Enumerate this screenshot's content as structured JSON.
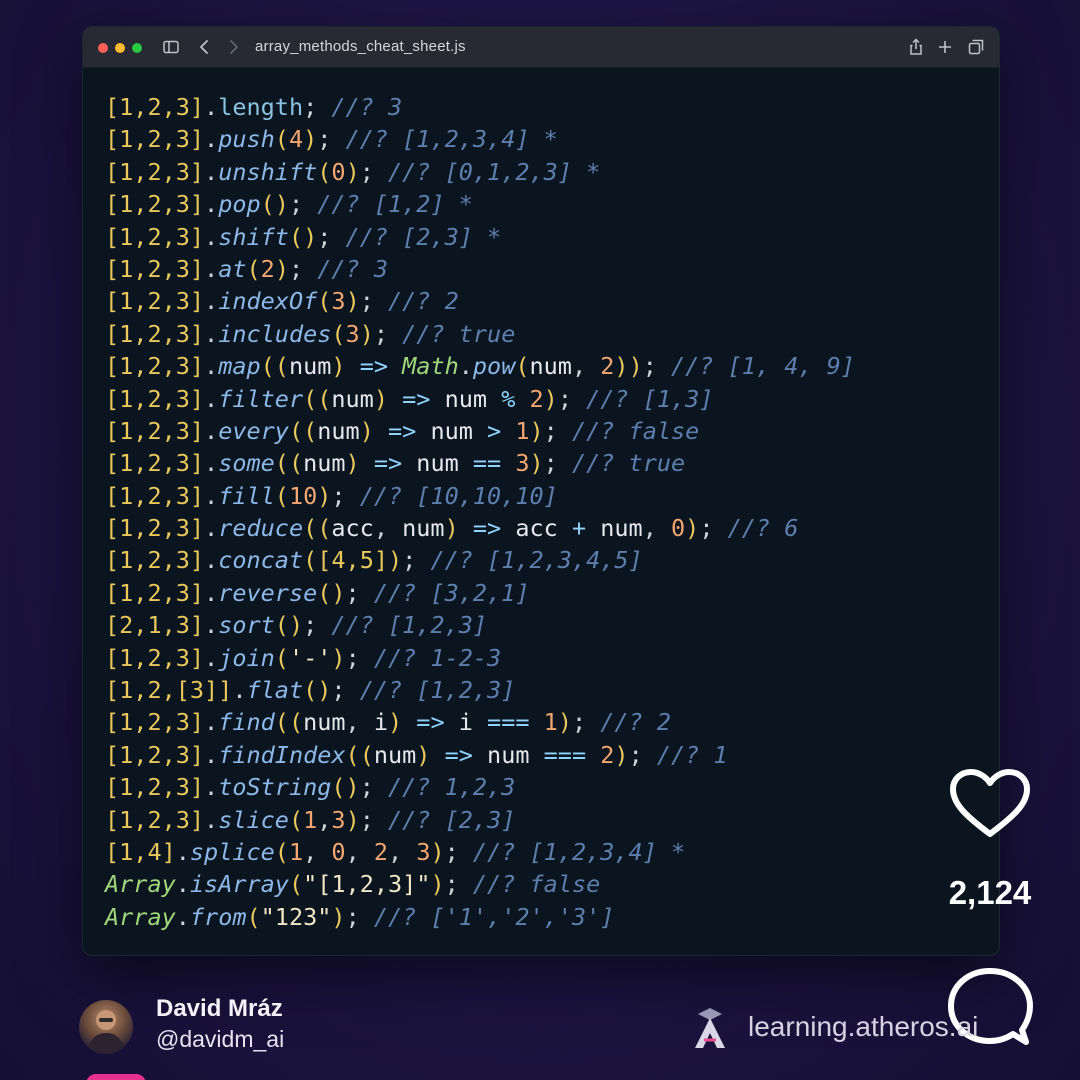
{
  "window": {
    "title": "array_methods_cheat_sheet.js"
  },
  "code_lines": [
    [
      [
        "b",
        "[1,2,3]"
      ],
      [
        "d",
        "."
      ],
      [
        "p",
        "length"
      ],
      [
        "d",
        "; "
      ],
      [
        "c",
        "//? 3"
      ]
    ],
    [
      [
        "b",
        "[1,2,3]"
      ],
      [
        "d",
        "."
      ],
      [
        "m",
        "push"
      ],
      [
        "b",
        "("
      ],
      [
        "n",
        "4"
      ],
      [
        "b",
        ")"
      ],
      [
        "d",
        "; "
      ],
      [
        "c",
        "//? [1,2,3,4] *"
      ]
    ],
    [
      [
        "b",
        "[1,2,3]"
      ],
      [
        "d",
        "."
      ],
      [
        "m",
        "unshift"
      ],
      [
        "b",
        "("
      ],
      [
        "n",
        "0"
      ],
      [
        "b",
        ")"
      ],
      [
        "d",
        "; "
      ],
      [
        "c",
        "//? [0,1,2,3] *"
      ]
    ],
    [
      [
        "b",
        "[1,2,3]"
      ],
      [
        "d",
        "."
      ],
      [
        "m",
        "pop"
      ],
      [
        "b",
        "()"
      ],
      [
        "d",
        "; "
      ],
      [
        "c",
        "//? [1,2] *"
      ]
    ],
    [
      [
        "b",
        "[1,2,3]"
      ],
      [
        "d",
        "."
      ],
      [
        "m",
        "shift"
      ],
      [
        "b",
        "()"
      ],
      [
        "d",
        "; "
      ],
      [
        "c",
        "//? [2,3] *"
      ]
    ],
    [
      [
        "b",
        "[1,2,3]"
      ],
      [
        "d",
        "."
      ],
      [
        "m",
        "at"
      ],
      [
        "b",
        "("
      ],
      [
        "n",
        "2"
      ],
      [
        "b",
        ")"
      ],
      [
        "d",
        "; "
      ],
      [
        "c",
        "//? 3"
      ]
    ],
    [
      [
        "b",
        "[1,2,3]"
      ],
      [
        "d",
        "."
      ],
      [
        "m",
        "indexOf"
      ],
      [
        "b",
        "("
      ],
      [
        "n",
        "3"
      ],
      [
        "b",
        ")"
      ],
      [
        "d",
        "; "
      ],
      [
        "c",
        "//? 2"
      ]
    ],
    [
      [
        "b",
        "[1,2,3]"
      ],
      [
        "d",
        "."
      ],
      [
        "m",
        "includes"
      ],
      [
        "b",
        "("
      ],
      [
        "n",
        "3"
      ],
      [
        "b",
        ")"
      ],
      [
        "d",
        "; "
      ],
      [
        "c",
        "//? true"
      ]
    ],
    [
      [
        "b",
        "[1,2,3]"
      ],
      [
        "d",
        "."
      ],
      [
        "m",
        "map"
      ],
      [
        "b",
        "(("
      ],
      [
        "v",
        "num"
      ],
      [
        "b",
        ")"
      ],
      [
        "o",
        " => "
      ],
      [
        "g",
        "Math"
      ],
      [
        "d",
        "."
      ],
      [
        "m",
        "pow"
      ],
      [
        "b",
        "("
      ],
      [
        "v",
        "num"
      ],
      [
        "d",
        ", "
      ],
      [
        "n",
        "2"
      ],
      [
        "b",
        "))"
      ],
      [
        "d",
        "; "
      ],
      [
        "c",
        "//? [1, 4, 9]"
      ]
    ],
    [
      [
        "b",
        "[1,2,3]"
      ],
      [
        "d",
        "."
      ],
      [
        "m",
        "filter"
      ],
      [
        "b",
        "(("
      ],
      [
        "v",
        "num"
      ],
      [
        "b",
        ")"
      ],
      [
        "o",
        " => "
      ],
      [
        "v",
        "num"
      ],
      [
        "o",
        " % "
      ],
      [
        "n",
        "2"
      ],
      [
        "b",
        ")"
      ],
      [
        "d",
        "; "
      ],
      [
        "c",
        "//? [1,3]"
      ]
    ],
    [
      [
        "b",
        "[1,2,3]"
      ],
      [
        "d",
        "."
      ],
      [
        "m",
        "every"
      ],
      [
        "b",
        "(("
      ],
      [
        "v",
        "num"
      ],
      [
        "b",
        ")"
      ],
      [
        "o",
        " => "
      ],
      [
        "v",
        "num"
      ],
      [
        "o",
        " > "
      ],
      [
        "n",
        "1"
      ],
      [
        "b",
        ")"
      ],
      [
        "d",
        "; "
      ],
      [
        "c",
        "//? false"
      ]
    ],
    [
      [
        "b",
        "[1,2,3]"
      ],
      [
        "d",
        "."
      ],
      [
        "m",
        "some"
      ],
      [
        "b",
        "(("
      ],
      [
        "v",
        "num"
      ],
      [
        "b",
        ")"
      ],
      [
        "o",
        " => "
      ],
      [
        "v",
        "num"
      ],
      [
        "o",
        " == "
      ],
      [
        "n",
        "3"
      ],
      [
        "b",
        ")"
      ],
      [
        "d",
        "; "
      ],
      [
        "c",
        "//? true"
      ]
    ],
    [
      [
        "b",
        "[1,2,3]"
      ],
      [
        "d",
        "."
      ],
      [
        "m",
        "fill"
      ],
      [
        "b",
        "("
      ],
      [
        "n",
        "10"
      ],
      [
        "b",
        ")"
      ],
      [
        "d",
        "; "
      ],
      [
        "c",
        "//? [10,10,10]"
      ]
    ],
    [
      [
        "b",
        "[1,2,3]"
      ],
      [
        "d",
        "."
      ],
      [
        "m",
        "reduce"
      ],
      [
        "b",
        "(("
      ],
      [
        "v",
        "acc"
      ],
      [
        "d",
        ", "
      ],
      [
        "v",
        "num"
      ],
      [
        "b",
        ")"
      ],
      [
        "o",
        " => "
      ],
      [
        "v",
        "acc"
      ],
      [
        "o",
        " + "
      ],
      [
        "v",
        "num"
      ],
      [
        "d",
        ", "
      ],
      [
        "n",
        "0"
      ],
      [
        "b",
        ")"
      ],
      [
        "d",
        "; "
      ],
      [
        "c",
        "//? 6"
      ]
    ],
    [
      [
        "b",
        "[1,2,3]"
      ],
      [
        "d",
        "."
      ],
      [
        "m",
        "concat"
      ],
      [
        "b",
        "("
      ],
      [
        "b",
        "[4,5]"
      ],
      [
        "b",
        ")"
      ],
      [
        "d",
        "; "
      ],
      [
        "c",
        "//? [1,2,3,4,5]"
      ]
    ],
    [
      [
        "b",
        "[1,2,3]"
      ],
      [
        "d",
        "."
      ],
      [
        "m",
        "reverse"
      ],
      [
        "b",
        "()"
      ],
      [
        "d",
        "; "
      ],
      [
        "c",
        "//? [3,2,1]"
      ]
    ],
    [
      [
        "b",
        "[2,1,3]"
      ],
      [
        "d",
        "."
      ],
      [
        "m",
        "sort"
      ],
      [
        "b",
        "()"
      ],
      [
        "d",
        "; "
      ],
      [
        "c",
        "//? [1,2,3]"
      ]
    ],
    [
      [
        "b",
        "[1,2,3]"
      ],
      [
        "d",
        "."
      ],
      [
        "m",
        "join"
      ],
      [
        "b",
        "("
      ],
      [
        "s",
        "'-'"
      ],
      [
        "b",
        ")"
      ],
      [
        "d",
        "; "
      ],
      [
        "c",
        "//? 1-2-3"
      ]
    ],
    [
      [
        "b",
        "[1,2,[3]]"
      ],
      [
        "d",
        "."
      ],
      [
        "m",
        "flat"
      ],
      [
        "b",
        "()"
      ],
      [
        "d",
        "; "
      ],
      [
        "c",
        "//? [1,2,3]"
      ]
    ],
    [
      [
        "b",
        "[1,2,3]"
      ],
      [
        "d",
        "."
      ],
      [
        "m",
        "find"
      ],
      [
        "b",
        "(("
      ],
      [
        "v",
        "num"
      ],
      [
        "d",
        ", "
      ],
      [
        "v",
        "i"
      ],
      [
        "b",
        ")"
      ],
      [
        "o",
        " => "
      ],
      [
        "v",
        "i"
      ],
      [
        "o",
        " === "
      ],
      [
        "n",
        "1"
      ],
      [
        "b",
        ")"
      ],
      [
        "d",
        "; "
      ],
      [
        "c",
        "//? 2"
      ]
    ],
    [
      [
        "b",
        "[1,2,3]"
      ],
      [
        "d",
        "."
      ],
      [
        "m",
        "findIndex"
      ],
      [
        "b",
        "(("
      ],
      [
        "v",
        "num"
      ],
      [
        "b",
        ")"
      ],
      [
        "o",
        " => "
      ],
      [
        "v",
        "num"
      ],
      [
        "o",
        " === "
      ],
      [
        "n",
        "2"
      ],
      [
        "b",
        ")"
      ],
      [
        "d",
        "; "
      ],
      [
        "c",
        "//? 1"
      ]
    ],
    [
      [
        "b",
        "[1,2,3]"
      ],
      [
        "d",
        "."
      ],
      [
        "m",
        "toString"
      ],
      [
        "b",
        "()"
      ],
      [
        "d",
        "; "
      ],
      [
        "c",
        "//? 1,2,3"
      ]
    ],
    [
      [
        "b",
        "[1,2,3]"
      ],
      [
        "d",
        "."
      ],
      [
        "m",
        "slice"
      ],
      [
        "b",
        "("
      ],
      [
        "n",
        "1"
      ],
      [
        "d",
        ","
      ],
      [
        "n",
        "3"
      ],
      [
        "b",
        ")"
      ],
      [
        "d",
        "; "
      ],
      [
        "c",
        "//? [2,3]"
      ]
    ],
    [
      [
        "b",
        "[1,4]"
      ],
      [
        "d",
        "."
      ],
      [
        "m",
        "splice"
      ],
      [
        "b",
        "("
      ],
      [
        "n",
        "1"
      ],
      [
        "d",
        ", "
      ],
      [
        "n",
        "0"
      ],
      [
        "d",
        ", "
      ],
      [
        "n",
        "2"
      ],
      [
        "d",
        ", "
      ],
      [
        "n",
        "3"
      ],
      [
        "b",
        ")"
      ],
      [
        "d",
        "; "
      ],
      [
        "c",
        "//? [1,2,3,4] *"
      ]
    ],
    [
      [
        "g",
        "Array"
      ],
      [
        "d",
        "."
      ],
      [
        "m",
        "isArray"
      ],
      [
        "b",
        "("
      ],
      [
        "s",
        "\"[1,2,3]\""
      ],
      [
        "b",
        ")"
      ],
      [
        "d",
        "; "
      ],
      [
        "c",
        "//? false"
      ]
    ],
    [
      [
        "g",
        "Array"
      ],
      [
        "d",
        "."
      ],
      [
        "m",
        "from"
      ],
      [
        "b",
        "("
      ],
      [
        "s",
        "\"123\""
      ],
      [
        "b",
        ")"
      ],
      [
        "d",
        "; "
      ],
      [
        "c",
        "//? ['1','2','3']"
      ]
    ]
  ],
  "actions": {
    "like_count": "2,124",
    "like_icon": "heart-icon",
    "comment_icon": "comment-icon"
  },
  "author": {
    "name": "David Mráz",
    "handle": "@davidm_ai"
  },
  "brand": {
    "text": "learning.atheros.ai"
  },
  "colors": {
    "background": "#1c1442",
    "editor_bg": "#0a1520",
    "comment": "#5c7fae",
    "bracket": "#e9c75a",
    "number": "#f3a66f"
  }
}
